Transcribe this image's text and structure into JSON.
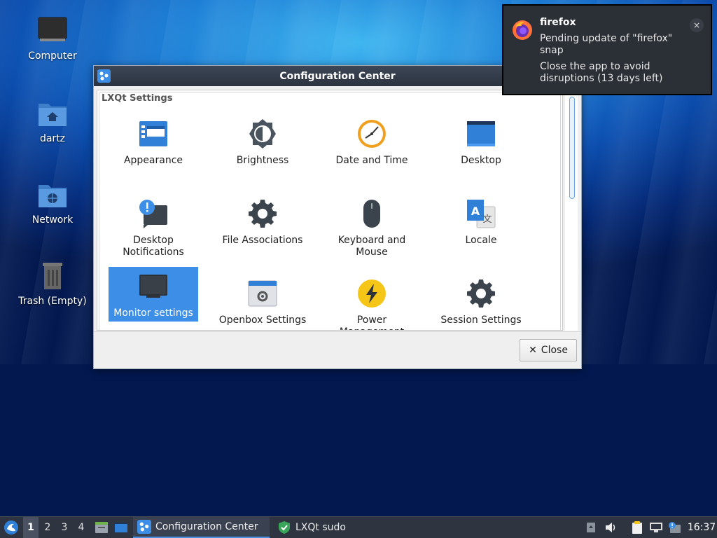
{
  "desktop": {
    "icons": [
      {
        "label": "Computer"
      },
      {
        "label": "dartz"
      },
      {
        "label": "Network"
      },
      {
        "label": "Trash (Empty)"
      }
    ]
  },
  "window": {
    "title": "Configuration Center",
    "group_label": "LXQt Settings",
    "items": [
      {
        "label": "Appearance",
        "icon": "appearance-icon"
      },
      {
        "label": "Brightness",
        "icon": "brightness-icon"
      },
      {
        "label": "Date and Time",
        "icon": "clock-icon"
      },
      {
        "label": "Desktop",
        "icon": "desktop-icon"
      },
      {
        "label": "Desktop Notifications",
        "icon": "notification-icon"
      },
      {
        "label": "File Associations",
        "icon": "gear-icon"
      },
      {
        "label": "Keyboard and Mouse",
        "icon": "mouse-icon"
      },
      {
        "label": "Locale",
        "icon": "locale-icon"
      },
      {
        "label": "Monitor settings",
        "icon": "monitor-icon",
        "selected": true
      },
      {
        "label": "Openbox Settings",
        "icon": "openbox-icon"
      },
      {
        "label": "Power Management",
        "icon": "power-icon"
      },
      {
        "label": "Session Settings",
        "icon": "gear-icon"
      }
    ],
    "close_label": "Close"
  },
  "notification": {
    "app": "firefox",
    "line1": "Pending update of \"firefox\" snap",
    "line2": "Close the app to avoid disruptions (13 days left)",
    "close_glyph": "×"
  },
  "taskbar": {
    "desktops": [
      "1",
      "2",
      "3",
      "4"
    ],
    "active_desktop": "1",
    "tasks": [
      {
        "label": "Configuration Center"
      },
      {
        "label": "LXQt sudo"
      }
    ],
    "clock": "16:37"
  },
  "colors": {
    "accent": "#3d8ee6",
    "titlebar": "#2e3440",
    "panel": "#2f3540"
  }
}
